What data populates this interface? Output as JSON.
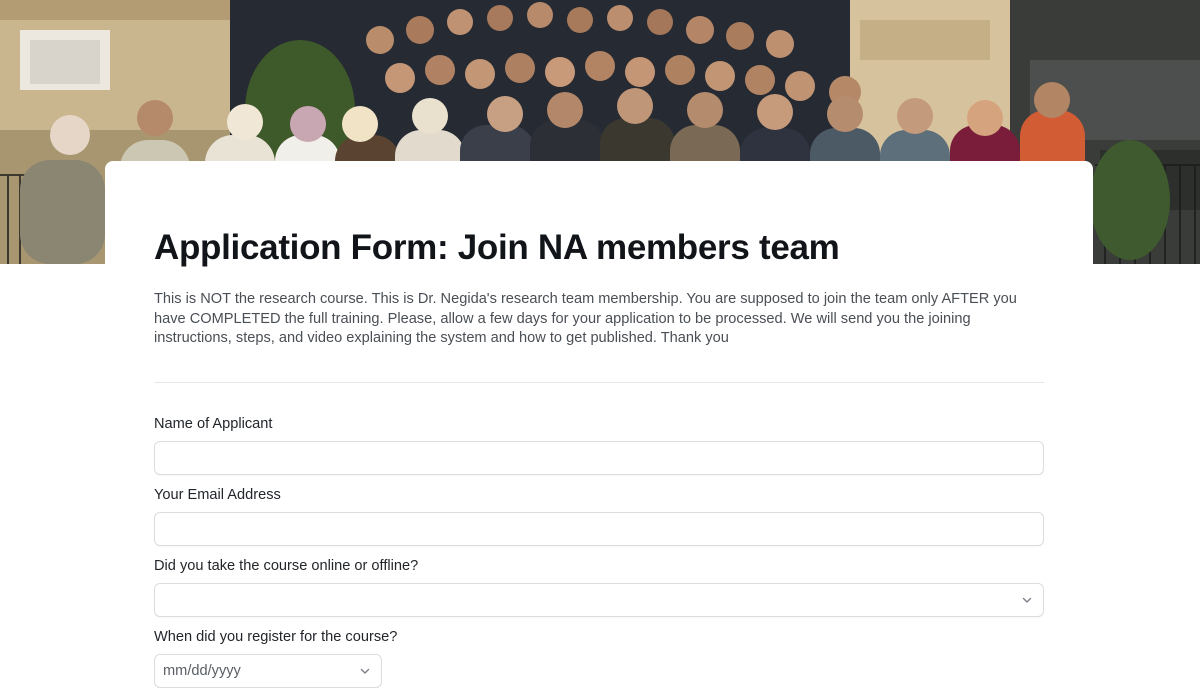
{
  "form": {
    "title": "Application Form: Join NA members team",
    "description": "This is NOT the research course. This is Dr. Negida's research team membership. You are supposed to join the team only AFTER you have COMPLETED the full training. Please, allow a few days for your application to be processed. We will send you the joining instructions, steps, and video explaining the system and how to get published. Thank you",
    "fields": [
      {
        "label": "Name of Applicant",
        "value": ""
      },
      {
        "label": "Your Email Address",
        "value": ""
      },
      {
        "label": "Did you take the course online or offline?",
        "selected": ""
      },
      {
        "label": "When did you register for the course?",
        "placeholder": "mm/dd/yyyy"
      }
    ]
  },
  "icons": {
    "select_chevron": "chevron-down-icon",
    "date_chevron": "chevron-down-icon"
  },
  "colors": {
    "title": "#111418",
    "description": "#4a4f55",
    "border": "#dcdde0"
  }
}
